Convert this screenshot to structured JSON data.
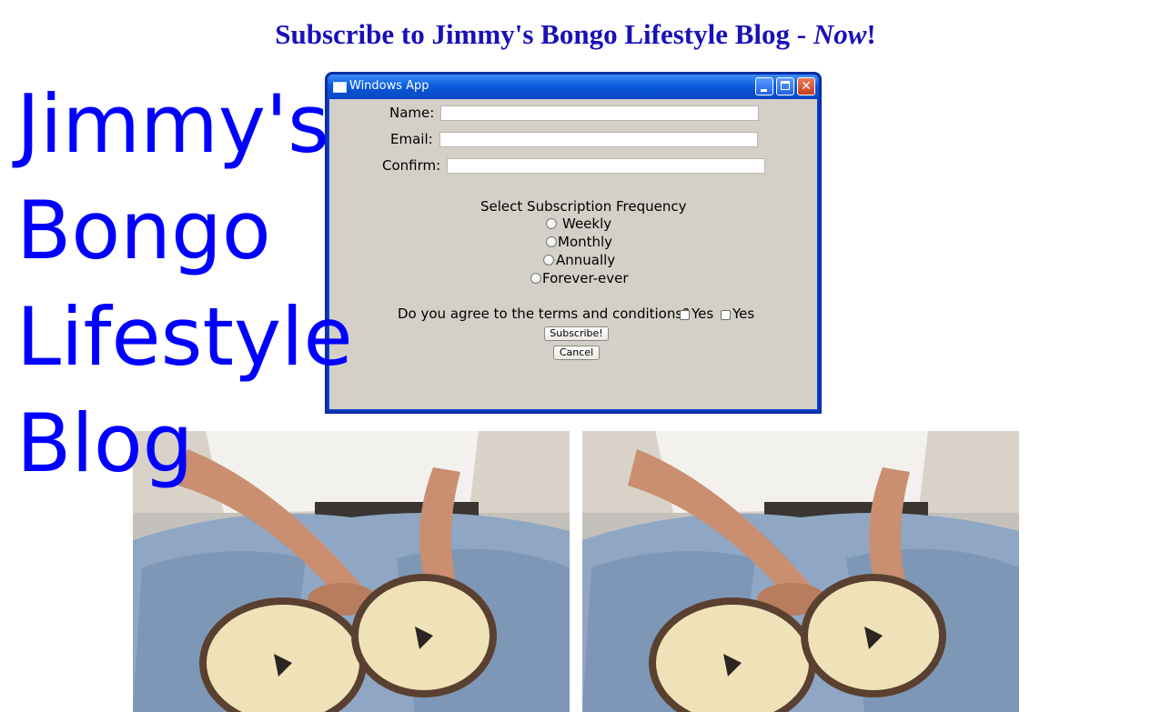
{
  "header": {
    "banner_text": "Subscribe to Jimmy's Bongo Lifestyle Blog - ",
    "banner_emphasis": "Now",
    "banner_end": "!"
  },
  "hero": {
    "lines": [
      "Jimmy's",
      "Bongo",
      "Lifestyle",
      "Blog"
    ]
  },
  "window": {
    "title": "Windows App",
    "form": {
      "name_label": "Name:",
      "name_value": "",
      "email_label": "Email:",
      "email_value": "",
      "confirm_label": "Confirm:",
      "confirm_value": "",
      "frequency_heading": "Select Subscription Frequency",
      "frequency_options": [
        "Weekly",
        "Monthly",
        "Annually",
        "Forever-ever"
      ],
      "terms_question": "Do you agree to the terms and conditions?",
      "terms_options": [
        "Yes",
        "Yes"
      ],
      "subscribe_label": "Subscribe!",
      "cancel_label": "Cancel"
    }
  },
  "images": [
    "bongo-photo",
    "bongo-photo"
  ],
  "colors": {
    "banner": "#1a10b8",
    "hero": "#0000ff",
    "window_frame": "#0a3fd1",
    "window_client": "#d4d0c8"
  }
}
